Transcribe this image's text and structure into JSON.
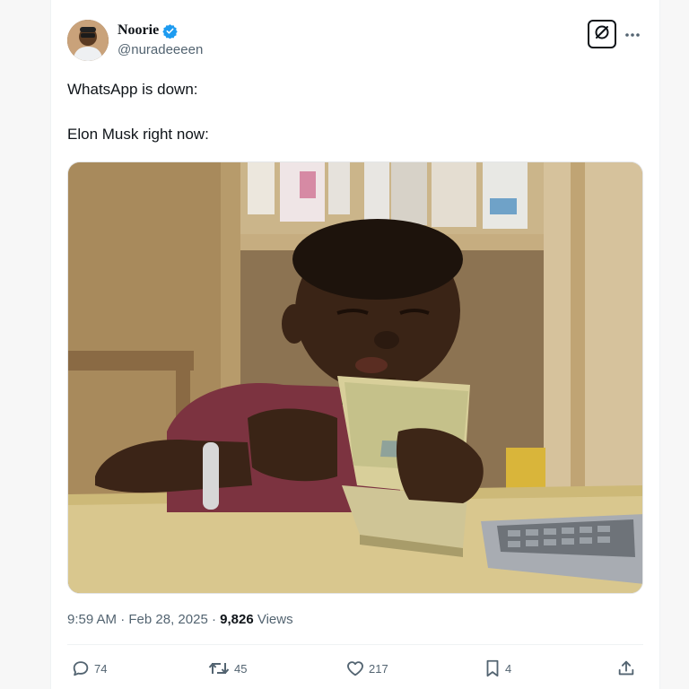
{
  "author": {
    "display_name": "Noorie",
    "handle": "@nuradeeeen",
    "verified": true,
    "avatar": "avatar"
  },
  "header_icons": {
    "grok": "grok-icon",
    "more": "more-icon"
  },
  "tweet": {
    "line1": "WhatsApp is down:",
    "line2": "Elon Musk right now:"
  },
  "media": {
    "kind": "photo"
  },
  "meta": {
    "time": "9:59 AM",
    "separator1": " · ",
    "date": "Feb 28, 2025",
    "separator2": " · ",
    "views": "9,826",
    "views_label": " Views"
  },
  "actions": {
    "replies": "74",
    "reposts": "45",
    "likes": "217",
    "bookmarks": "4"
  },
  "colors": {
    "text_primary": "#0f1419",
    "text_secondary": "#536471",
    "verified_blue": "#1d9bf0"
  }
}
